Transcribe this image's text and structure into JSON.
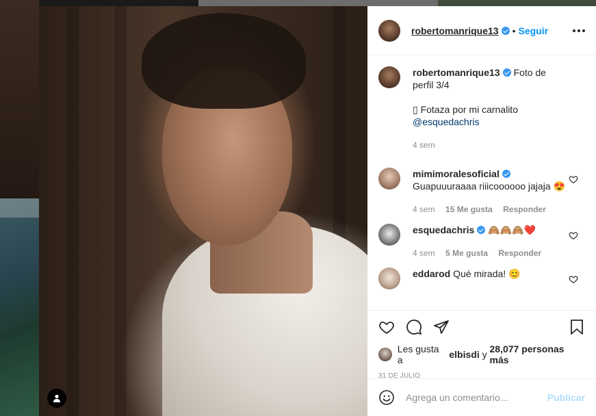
{
  "post": {
    "username": "robertomanrique13",
    "follow_label": "Seguir",
    "caption": {
      "username": "robertomanrique13",
      "text_line1": "Foto de perfil 3/4",
      "text_line2": "▯ Fotaza por mi carnalito",
      "mention": "@esquedachris",
      "time": "4 sem"
    },
    "comments": [
      {
        "username": "mimimoralesoficial",
        "verified": true,
        "text": "Guapuuuraaaa riiicoooooo jajaja 😍",
        "time": "4 sem",
        "likes": "15 Me gusta",
        "reply": "Responder"
      },
      {
        "username": "esquedachris",
        "verified": true,
        "text": "🙈🙈🙈❤️",
        "time": "4 sem",
        "likes": "5 Me gusta",
        "reply": "Responder"
      },
      {
        "username": "eddarod",
        "verified": false,
        "text": "Qué mirada! 😊"
      }
    ],
    "likes_text": {
      "prefix": "Les gusta a",
      "user": "elbisdi",
      "connector": "y",
      "count": "28,077 personas más"
    },
    "date": "31 DE JULIO",
    "add_comment_placeholder": "Agrega un comentario...",
    "publish_label": "Publicar"
  },
  "colors": {
    "link_blue": "#0095f6",
    "verified_blue": "#3897f0",
    "muted": "#8e8e8e",
    "publish_disabled": "#b2dffc"
  },
  "icons": [
    "more-options-icon",
    "verified-icon",
    "heart-icon",
    "comment-icon",
    "share-icon",
    "bookmark-icon",
    "emoji-icon",
    "user-tag-icon"
  ]
}
